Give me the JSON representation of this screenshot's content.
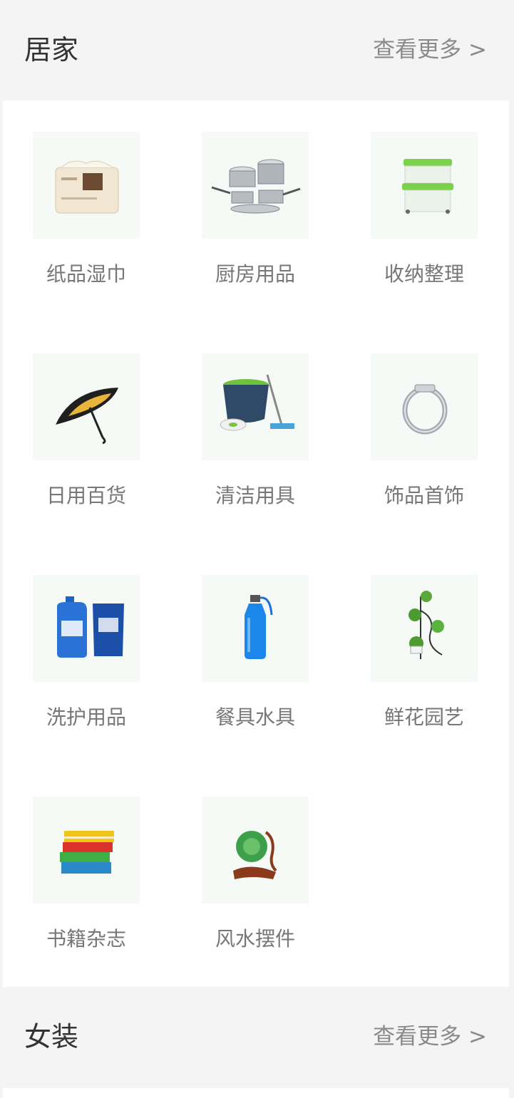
{
  "sections": [
    {
      "title": "居家",
      "more_label": "查看更多 >",
      "items": [
        {
          "label": "纸品湿巾",
          "icon": "tissue-pack-icon"
        },
        {
          "label": "厨房用品",
          "icon": "cookware-set-icon"
        },
        {
          "label": "收纳整理",
          "icon": "storage-box-icon"
        },
        {
          "label": "日用百货",
          "icon": "umbrella-icon"
        },
        {
          "label": "清洁用具",
          "icon": "mop-bucket-icon"
        },
        {
          "label": "饰品首饰",
          "icon": "ring-icon"
        },
        {
          "label": "洗护用品",
          "icon": "detergent-icon"
        },
        {
          "label": "餐具水具",
          "icon": "water-bottle-icon"
        },
        {
          "label": "鲜花园艺",
          "icon": "plant-stand-icon"
        },
        {
          "label": "书籍杂志",
          "icon": "books-icon"
        },
        {
          "label": "风水摆件",
          "icon": "ornament-icon"
        }
      ]
    },
    {
      "title": "女装",
      "more_label": "查看更多 >"
    }
  ],
  "colors": {
    "page_background": "#f4f4f4",
    "panel_background": "#ffffff",
    "thumb_background": "#f6faf6",
    "title_text": "#333333",
    "label_text": "#777777",
    "link_text": "#8a8a8a"
  }
}
